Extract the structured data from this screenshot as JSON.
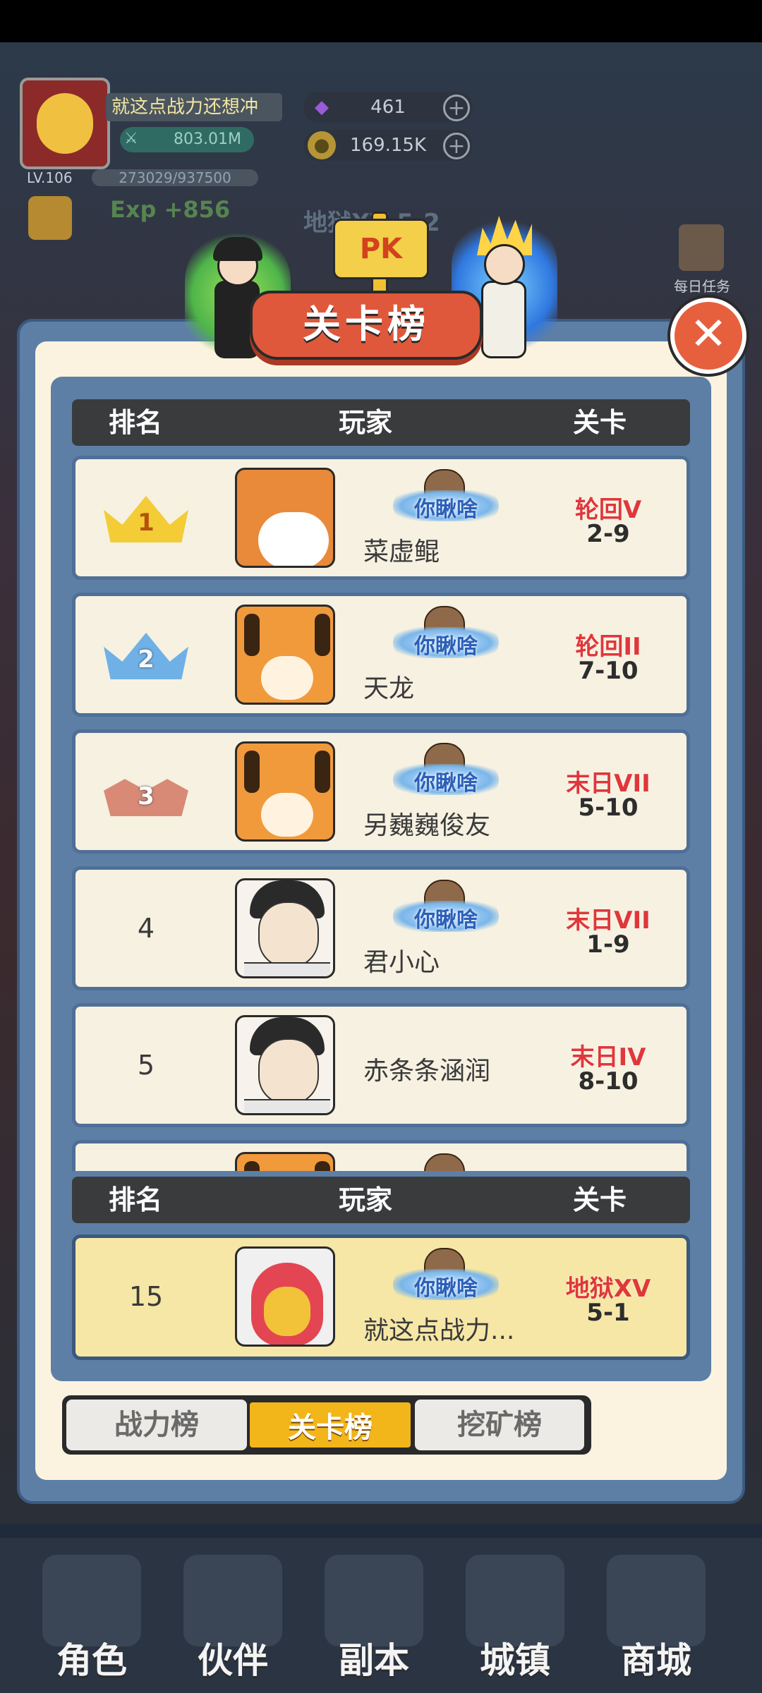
{
  "player": {
    "name": "就这点战力还想冲",
    "power": "803.01M",
    "level": "LV.106",
    "exp": "273029/937500",
    "exp_gain": "Exp +856",
    "gems": "461",
    "coins": "169.15K",
    "stage_bg": "地狱XV 5-2"
  },
  "daily_task_label": "每日任务",
  "modal": {
    "title": "关卡榜",
    "pk_label": "PK",
    "close_symbol": "✕",
    "headers": {
      "rank": "排名",
      "player": "玩家",
      "stage": "关卡"
    },
    "rows": [
      {
        "rank": "1",
        "medal": "gold",
        "avatar": "shiba",
        "badge": "你瞅啥",
        "name": "菜虚鲲",
        "realm": "轮回V",
        "level": "2-9"
      },
      {
        "rank": "2",
        "medal": "silver",
        "avatar": "tiger",
        "badge": "你瞅啥",
        "name": "天龙",
        "realm": "轮回II",
        "level": "7-10"
      },
      {
        "rank": "3",
        "medal": "bronze",
        "avatar": "tiger",
        "badge": "你瞅啥",
        "name": "另巍巍俊友",
        "realm": "末日VII",
        "level": "5-10"
      },
      {
        "rank": "4",
        "medal": "",
        "avatar": "man",
        "badge": "你瞅啥",
        "name": "君小心",
        "realm": "末日VII",
        "level": "1-9"
      },
      {
        "rank": "5",
        "medal": "",
        "avatar": "man",
        "badge": "",
        "name": "赤条条涵润",
        "realm": "末日IV",
        "level": "8-10"
      }
    ],
    "my_row": {
      "rank": "15",
      "avatar": "red",
      "badge": "你瞅啥",
      "name": "就这点战力...",
      "realm": "地狱XV",
      "level": "5-1"
    },
    "tabs": [
      {
        "label": "战力榜",
        "active": false
      },
      {
        "label": "关卡榜",
        "active": true
      },
      {
        "label": "挖矿榜",
        "active": false
      }
    ]
  },
  "nav": [
    "角色",
    "伙伴",
    "副本",
    "城镇",
    "商城"
  ],
  "colors": {
    "accent_red": "#e0583b",
    "tab_active": "#f2b51a",
    "realm_red": "#e0373a",
    "panel_blue": "#5d7fa6",
    "panel_cream": "#fbf3df"
  }
}
